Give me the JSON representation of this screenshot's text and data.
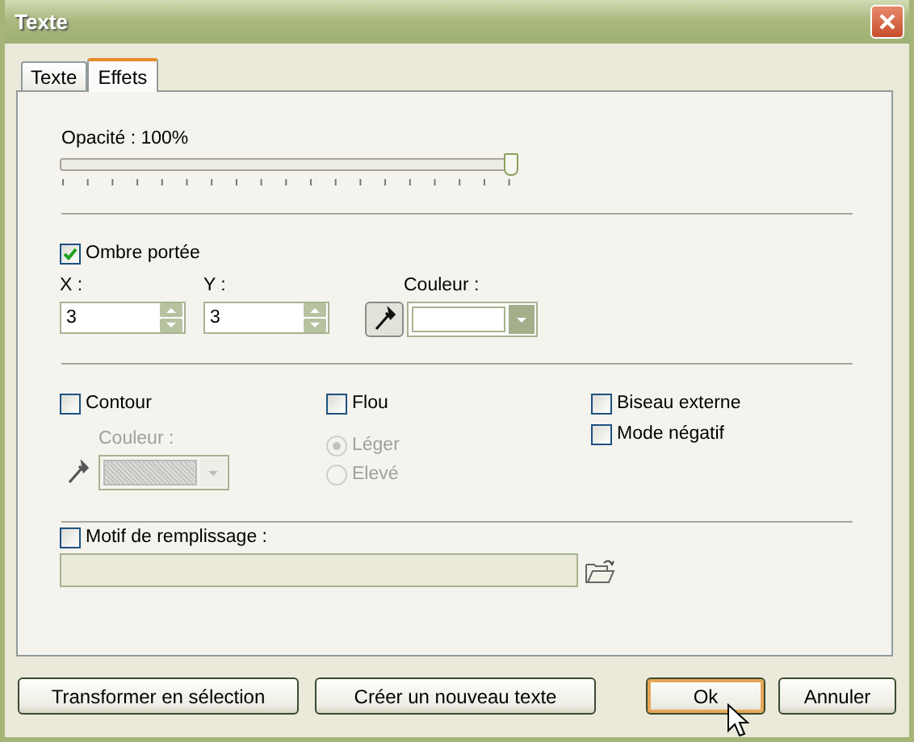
{
  "window": {
    "title": "Texte"
  },
  "tabs": [
    {
      "label": "Texte",
      "selected": false
    },
    {
      "label": "Effets",
      "selected": true
    }
  ],
  "opacity": {
    "label": "Opacité : 100%",
    "level": 1
  },
  "drop_shadow": {
    "label": "Ombre portée",
    "checked": true,
    "x_label": "X :",
    "x_value": "3",
    "y_label": "Y :",
    "y_value": "3",
    "color_label": "Couleur :"
  },
  "contour": {
    "label": "Contour",
    "checked": false,
    "color_label": "Couleur :",
    "disabled": true
  },
  "blur": {
    "label": "Flou",
    "checked": false,
    "options": [
      {
        "label": "Léger",
        "selected": true,
        "disabled": true
      },
      {
        "label": "Elevé",
        "selected": false,
        "disabled": true
      }
    ]
  },
  "other_effects": [
    {
      "label": "Biseau externe",
      "checked": false
    },
    {
      "label": "Mode négatif",
      "checked": false
    }
  ],
  "fill_pattern": {
    "label": "Motif de remplissage :",
    "checked": false,
    "disabled": true
  },
  "buttons": [
    {
      "label": "Transformer en sélection",
      "default": false
    },
    {
      "label": "Créer un nouveau texte",
      "default": false
    },
    {
      "label": "Ok",
      "default": true
    },
    {
      "label": "Annuler",
      "default": false
    }
  ]
}
